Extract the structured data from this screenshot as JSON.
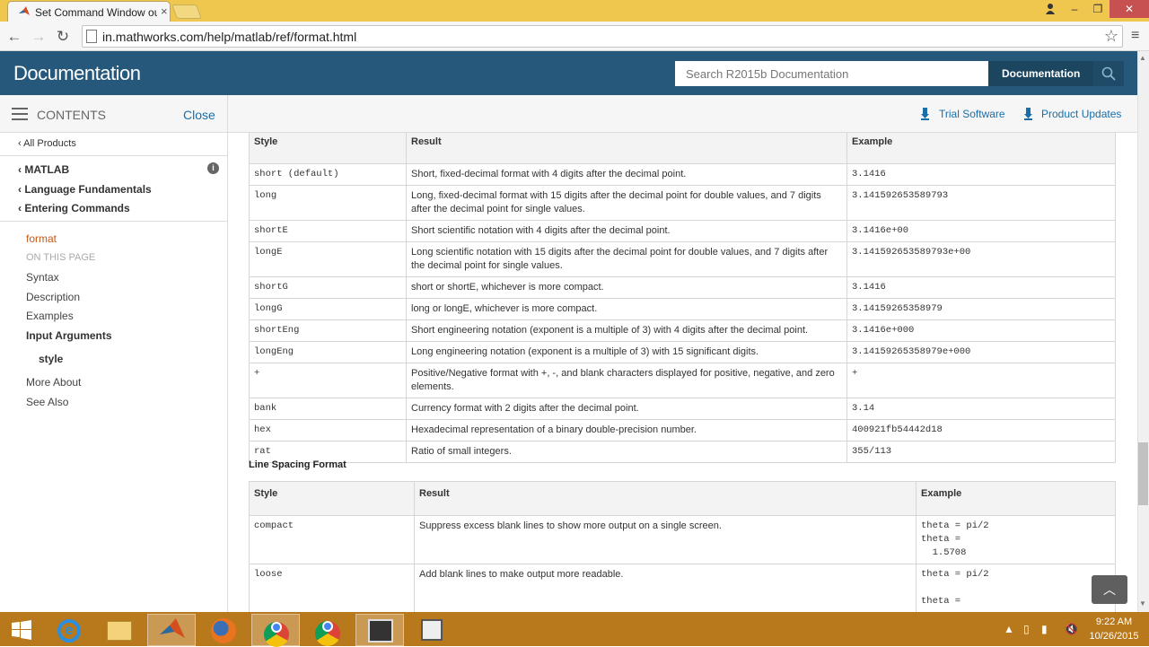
{
  "browser": {
    "tab_title": "Set Command Window ou",
    "url": "in.mathworks.com/help/matlab/ref/format.html",
    "icons": {
      "back": "back-arrow-icon",
      "forward": "forward-arrow-icon",
      "reload": "reload-icon",
      "star": "star-icon",
      "menu": "menu-icon"
    }
  },
  "header": {
    "brand": "Documentation",
    "search_placeholder": "Search R2015b Documentation",
    "scope_label": "Documentation",
    "colors": {
      "header_bg": "#25587a",
      "link": "#1a6ea8"
    }
  },
  "subheader": {
    "contents_label": "CONTENTS",
    "close_label": "Close",
    "trial_label": "Trial Software",
    "updates_label": "Product Updates"
  },
  "sidebar": {
    "all_products": "All Products",
    "breadcrumbs": [
      "MATLAB",
      "Language Fundamentals",
      "Entering Commands"
    ],
    "current": "format",
    "on_this_page": "ON THIS PAGE",
    "toc": [
      "Syntax",
      "Description",
      "Examples",
      "Input Arguments",
      "style",
      "More About",
      "See Also"
    ]
  },
  "format_table": {
    "headers": [
      "Style",
      "Result",
      "Example"
    ],
    "rows": [
      {
        "style": "short (default)",
        "result": "Short, fixed-decimal format with 4 digits after the decimal point.",
        "example": "3.1416"
      },
      {
        "style": "long",
        "result": "Long, fixed-decimal format with 15 digits after the decimal point for double values, and 7 digits after the decimal point for single values.",
        "example": "3.141592653589793"
      },
      {
        "style": "shortE",
        "result": "Short scientific notation with 4 digits after the decimal point.",
        "example": "3.1416e+00"
      },
      {
        "style": "longE",
        "result": "Long scientific notation with 15 digits after the decimal point for double values, and 7 digits after the decimal point for single values.",
        "example": "3.141592653589793e+00"
      },
      {
        "style": "shortG",
        "result": "short or shortE, whichever is more compact.",
        "example": "3.1416"
      },
      {
        "style": "longG",
        "result": "long or longE, whichever is more compact.",
        "example": "3.14159265358979"
      },
      {
        "style": "shortEng",
        "result": "Short engineering notation (exponent is a multiple of 3) with 4 digits after the decimal point.",
        "example": "3.1416e+000"
      },
      {
        "style": "longEng",
        "result": "Long engineering notation (exponent is a multiple of 3) with 15 significant digits.",
        "example": "3.14159265358979e+000"
      },
      {
        "style": "+",
        "result": "Positive/Negative format with +, -, and blank characters displayed for positive, negative, and zero elements.",
        "example": "+"
      },
      {
        "style": "bank",
        "result": "Currency format with 2 digits after the decimal point.",
        "example": "3.14"
      },
      {
        "style": "hex",
        "result": "Hexadecimal representation of a binary double-precision number.",
        "example": "400921fb54442d18"
      },
      {
        "style": "rat",
        "result": "Ratio of small integers.",
        "example": "355/113"
      }
    ]
  },
  "line_spacing": {
    "title": "Line Spacing Format",
    "headers": [
      "Style",
      "Result",
      "Example"
    ],
    "rows": [
      {
        "style": "compact",
        "result": "Suppress excess blank lines to show more output on a single screen.",
        "example": "theta = pi/2\ntheta =\n  1.5708"
      },
      {
        "style": "loose",
        "result": "Add blank lines to make output more readable.",
        "example": "theta = pi/2\n\ntheta ="
      }
    ]
  },
  "taskbar": {
    "time": "9:22 AM",
    "date": "10/26/2015"
  }
}
